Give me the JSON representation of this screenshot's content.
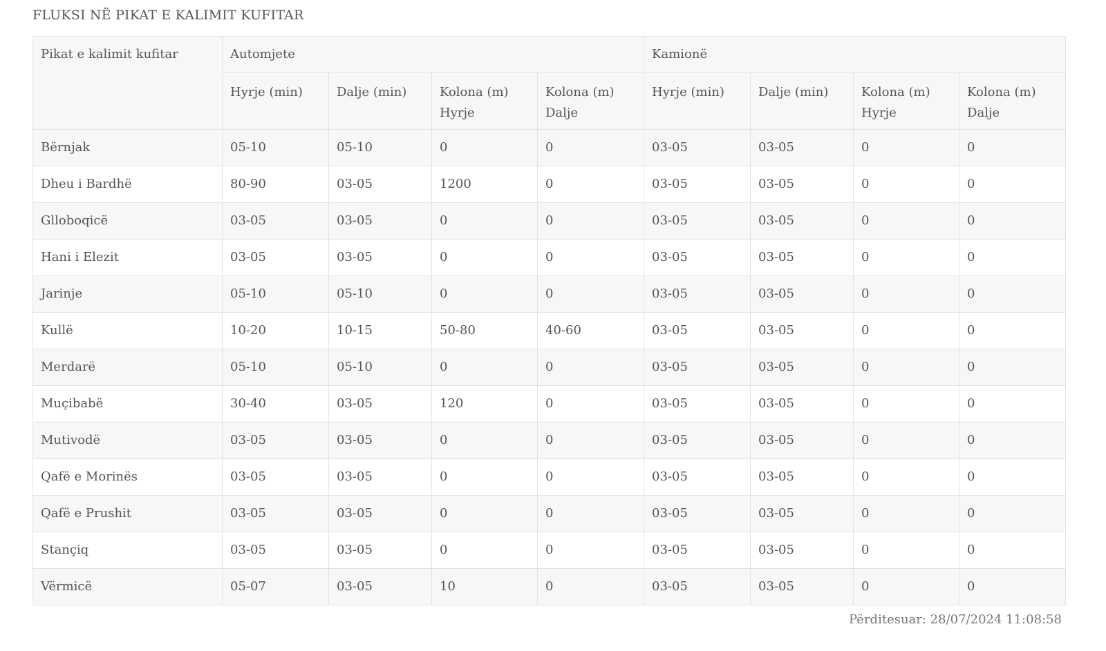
{
  "title": "FLUKSI NË PIKAT E KALIMIT KUFITAR",
  "table": {
    "station_header": "Pikat e kalimit kufitar",
    "groups": [
      "Automjete",
      "Kamionë"
    ],
    "subheaders": [
      {
        "line1": "Hyrje (min)",
        "line2": ""
      },
      {
        "line1": "Dalje (min)",
        "line2": ""
      },
      {
        "line1": "Kolona (m)",
        "line2": "Hyrje"
      },
      {
        "line1": "Kolona (m)",
        "line2": "Dalje"
      },
      {
        "line1": "Hyrje (min)",
        "line2": ""
      },
      {
        "line1": "Dalje (min)",
        "line2": ""
      },
      {
        "line1": "Kolona (m)",
        "line2": "Hyrje"
      },
      {
        "line1": "Kolona (m)",
        "line2": "Dalje"
      }
    ],
    "rows": [
      {
        "name": "Bërnjak",
        "values": [
          "05-10",
          "05-10",
          "0",
          "0",
          "03-05",
          "03-05",
          "0",
          "0"
        ]
      },
      {
        "name": "Dheu i Bardhë",
        "values": [
          "80-90",
          "03-05",
          "1200",
          "0",
          "03-05",
          "03-05",
          "0",
          "0"
        ]
      },
      {
        "name": "Glloboqicë",
        "values": [
          "03-05",
          "03-05",
          "0",
          "0",
          "03-05",
          "03-05",
          "0",
          "0"
        ]
      },
      {
        "name": "Hani i Elezit",
        "values": [
          "03-05",
          "03-05",
          "0",
          "0",
          "03-05",
          "03-05",
          "0",
          "0"
        ]
      },
      {
        "name": "Jarinje",
        "values": [
          "05-10",
          "05-10",
          "0",
          "0",
          "03-05",
          "03-05",
          "0",
          "0"
        ]
      },
      {
        "name": "Kullë",
        "values": [
          "10-20",
          "10-15",
          "50-80",
          "40-60",
          "03-05",
          "03-05",
          "0",
          "0"
        ]
      },
      {
        "name": "Merdarë",
        "values": [
          "05-10",
          "05-10",
          "0",
          "0",
          "03-05",
          "03-05",
          "0",
          "0"
        ]
      },
      {
        "name": "Muçibabë",
        "values": [
          "30-40",
          "03-05",
          "120",
          "0",
          "03-05",
          "03-05",
          "0",
          "0"
        ]
      },
      {
        "name": "Mutivodë",
        "values": [
          "03-05",
          "03-05",
          "0",
          "0",
          "03-05",
          "03-05",
          "0",
          "0"
        ]
      },
      {
        "name": "Qafë e Morinës",
        "values": [
          "03-05",
          "03-05",
          "0",
          "0",
          "03-05",
          "03-05",
          "0",
          "0"
        ]
      },
      {
        "name": "Qafë e Prushit",
        "values": [
          "03-05",
          "03-05",
          "0",
          "0",
          "03-05",
          "03-05",
          "0",
          "0"
        ]
      },
      {
        "name": "Stançiq",
        "values": [
          "03-05",
          "03-05",
          "0",
          "0",
          "03-05",
          "03-05",
          "0",
          "0"
        ]
      },
      {
        "name": "Vërmicë",
        "values": [
          "05-07",
          "03-05",
          "10",
          "0",
          "03-05",
          "03-05",
          "0",
          "0"
        ]
      }
    ]
  },
  "updated_label": "Përditesuar: 28/07/2024 11:08:58"
}
